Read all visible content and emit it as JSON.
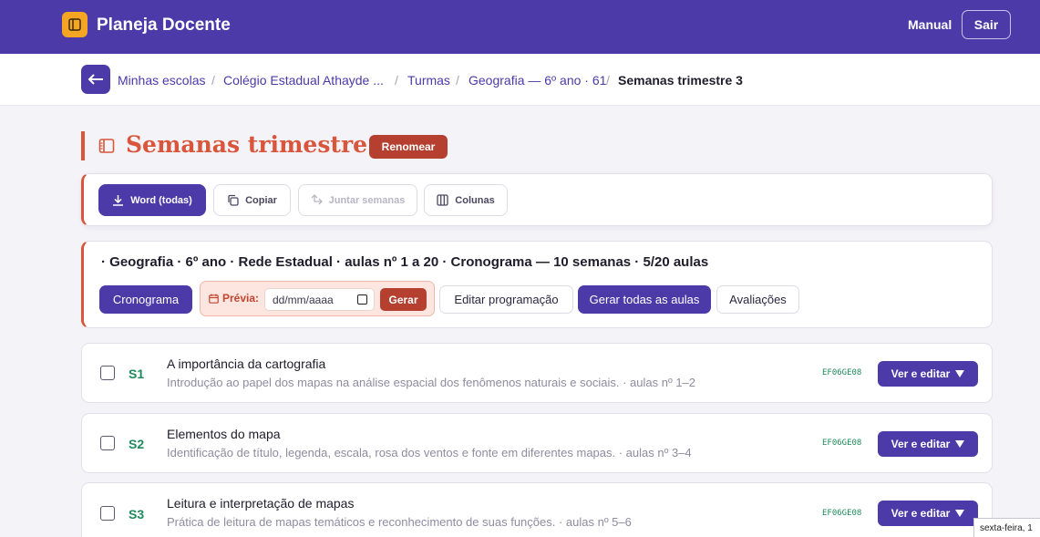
{
  "app": {
    "title": "Planeja Docente",
    "manual": "Manual",
    "logout": "Sair"
  },
  "breadcrumb": {
    "items": [
      "Minhas escolas",
      "Colégio Estadual Athayde ...",
      "Turmas",
      "Geografia — 6º ano · 61"
    ],
    "current": "Semanas trimestre 3",
    "separator": "/"
  },
  "page": {
    "title": "Semanas trimestre 3",
    "rename": "Renomear"
  },
  "toolbar": {
    "word": "Word (todas)",
    "copy": "Copiar",
    "merge": "Juntar semanas",
    "columns": "Colunas"
  },
  "info": {
    "summary": "· Geografia · 6º ano · Rede Estadual · aulas nº 1 a 20 · Cronograma — 10 semanas · 5/20 aulas",
    "cronograma": "Cronograma",
    "preview_label": "Prévia:",
    "date_placeholder": "dd/mm/aaaa",
    "generate": "Gerar",
    "edit_schedule": "Editar programação",
    "generate_all": "Gerar todas as aulas",
    "assessments": "Avaliações"
  },
  "weeks": [
    {
      "num": "S1",
      "title": "A importância da cartografia",
      "desc": "Introdução ao papel dos mapas na análise espacial dos fenômenos naturais e sociais. · aulas nº 1–2",
      "code": "EF06GE08",
      "action": "Ver e editar"
    },
    {
      "num": "S2",
      "title": "Elementos do mapa",
      "desc": "Identificação de título, legenda, escala, rosa dos ventos e fonte em diferentes mapas. · aulas nº 3–4",
      "code": "EF06GE08",
      "action": "Ver e editar"
    },
    {
      "num": "S3",
      "title": "Leitura e interpretação de mapas",
      "desc": "Prática de leitura de mapas temáticos e reconhecimento de suas funções. · aulas nº 5–6",
      "code": "EF06GE08",
      "action": "Ver e editar"
    }
  ],
  "tooltip": "sexta-feira, 1",
  "colors": {
    "brand": "#4c3aa8",
    "accent": "#d9553b",
    "danger": "#b5402f",
    "success": "#1e8a5a",
    "logo": "#f5a524"
  },
  "icons": [
    "book-icon",
    "arrow-left-icon",
    "download-icon",
    "copy-icon",
    "merge-icon",
    "columns-icon",
    "calendar-icon",
    "caret-down-icon"
  ]
}
